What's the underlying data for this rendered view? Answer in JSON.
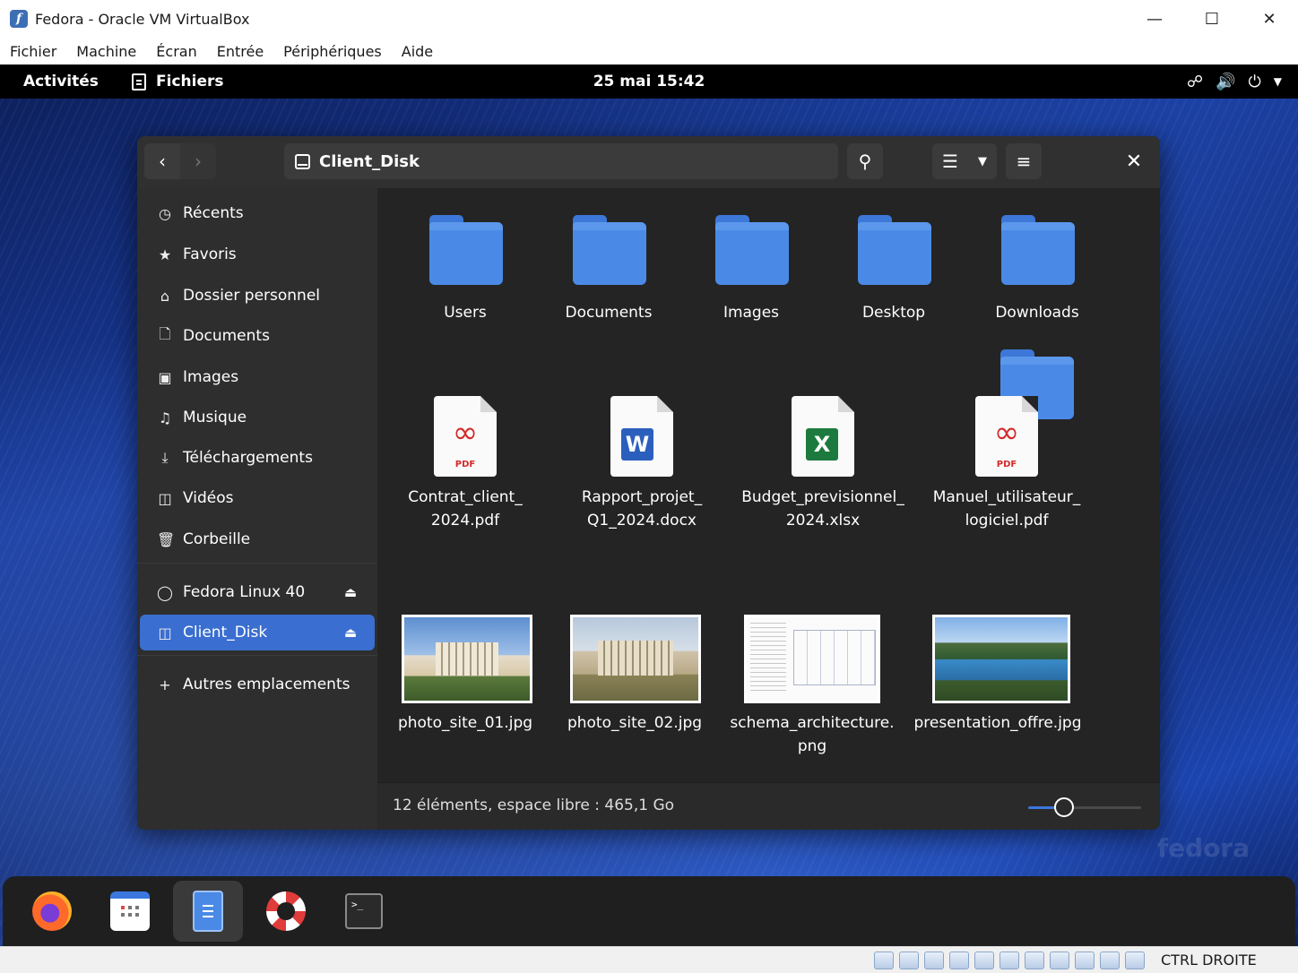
{
  "vbox": {
    "title": "Fedora - Oracle VM VirtualBox",
    "menu": [
      "Fichier",
      "Machine",
      "Écran",
      "Entrée",
      "Périphériques",
      "Aide"
    ],
    "host_key": "CTRL DROITE"
  },
  "topbar": {
    "activities": "Activités",
    "app_name": "Fichiers",
    "clock": "25 mai  15:42"
  },
  "files": {
    "location": "Client_Disk",
    "sidebar": {
      "places": [
        {
          "label": "Récents",
          "icon": "clock-icon"
        },
        {
          "label": "Favoris",
          "icon": "star-icon"
        },
        {
          "label": "Dossier personnel",
          "icon": "home-icon"
        },
        {
          "label": "Documents",
          "icon": "document-icon"
        },
        {
          "label": "Images",
          "icon": "image-icon"
        },
        {
          "label": "Musique",
          "icon": "music-icon"
        },
        {
          "label": "Téléchargements",
          "icon": "download-icon"
        },
        {
          "label": "Vidéos",
          "icon": "video-icon"
        },
        {
          "label": "Corbeille",
          "icon": "trash-icon"
        }
      ],
      "devices": [
        {
          "label": "Fedora Linux 40",
          "icon": "disc-icon",
          "active": false
        },
        {
          "label": "Client_Disk",
          "icon": "drive-icon",
          "active": true
        }
      ],
      "other": "Autres emplacements"
    },
    "items": [
      {
        "type": "folder",
        "name": "Users"
      },
      {
        "type": "folder",
        "name": "Documents"
      },
      {
        "type": "folder",
        "name": "Images"
      },
      {
        "type": "folder",
        "name": "Desktop"
      },
      {
        "type": "folder",
        "name": "Downloads"
      },
      {
        "type": "pdf",
        "name_line1": "Contrat_client_",
        "name_line2": "2024.pdf"
      },
      {
        "type": "docx",
        "name_line1": "Rapport_projet_",
        "name_line2": "Q1_2024.docx"
      },
      {
        "type": "xlsx",
        "name_line1": "Budget_previsionnel_",
        "name_line2": "2024.xlsx"
      },
      {
        "type": "pdf",
        "name_line1": "Manuel_utilisateur_",
        "name_line2": "logiciel.pdf"
      },
      {
        "type": "image",
        "name": "photo_site_01.jpg"
      },
      {
        "type": "image",
        "name": "photo_site_02.jpg"
      },
      {
        "type": "image",
        "name_line1": "schema_architecture.",
        "name_line2": "png"
      },
      {
        "type": "image",
        "name": "presentation_offre.jpg"
      }
    ],
    "status": "12 éléments, espace libre : 465,1 Go",
    "zoom_level": 0.32,
    "pdf_badge": "PDF",
    "word_badge": "W",
    "excel_badge": "X"
  },
  "desktop": {
    "watermark": "fedora"
  },
  "dock": [
    "Firefox",
    "Agenda",
    "Fichiers",
    "Aide",
    "Terminal"
  ],
  "colors": {
    "accent": "#3a6ed0",
    "folder": "#4a8ae6",
    "window_bg": "#242424",
    "sidebar_bg": "#2e2e2e"
  }
}
